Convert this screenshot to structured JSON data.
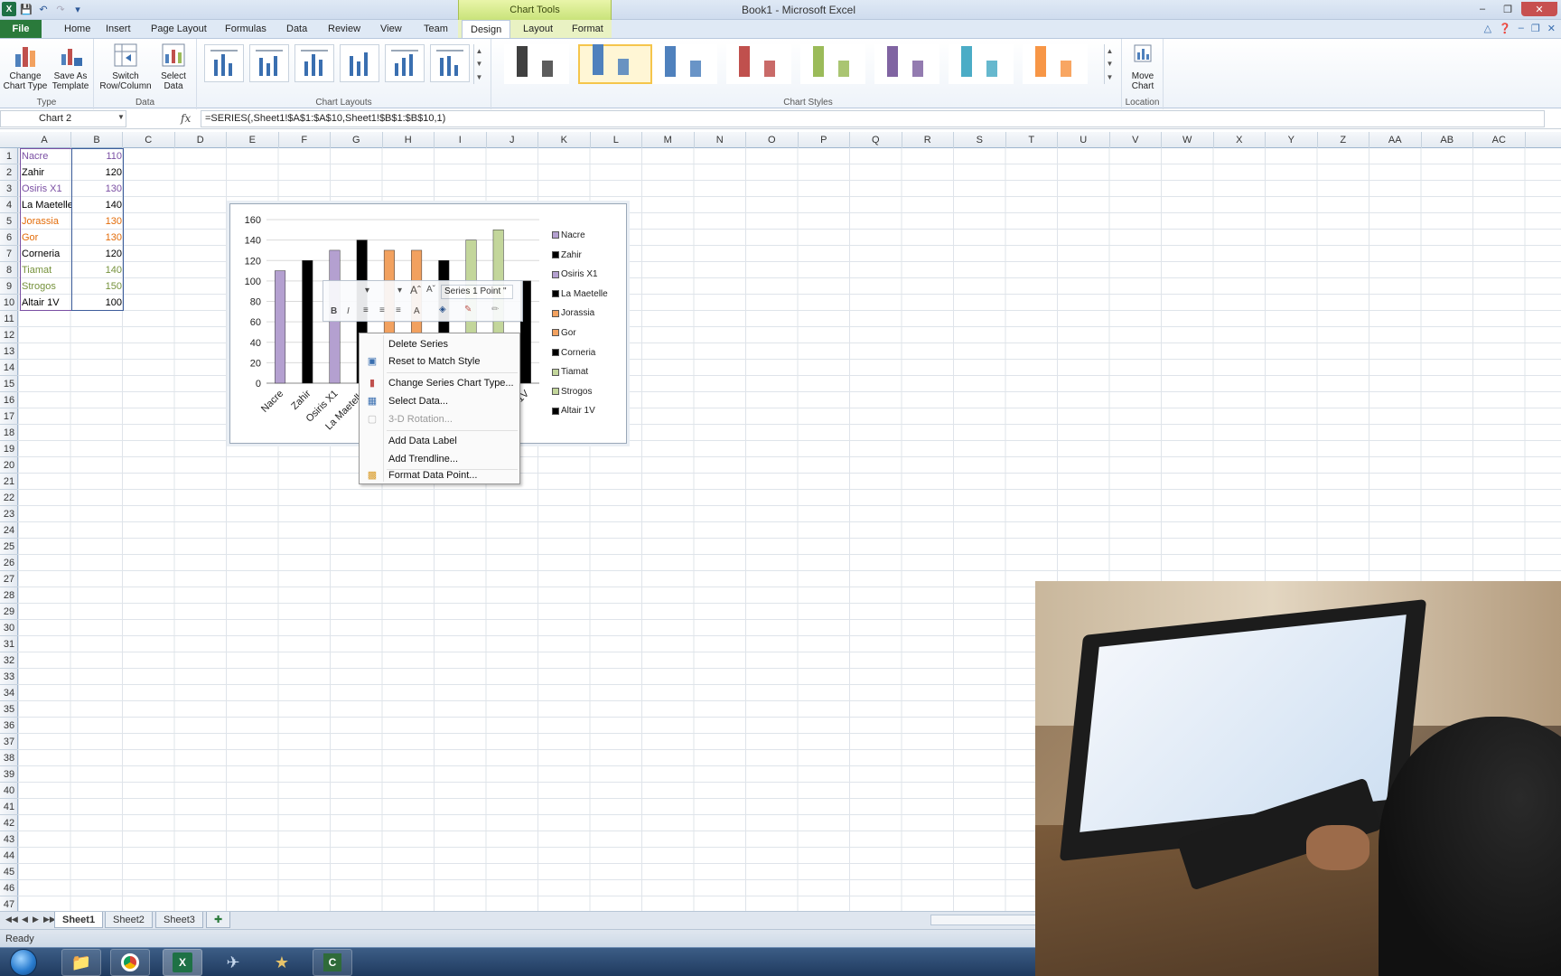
{
  "window": {
    "title": "Book1  -  Microsoft Excel",
    "contextual_tab_group": "Chart Tools"
  },
  "tabs": [
    {
      "label": "File"
    },
    {
      "label": "Home"
    },
    {
      "label": "Insert"
    },
    {
      "label": "Page Layout"
    },
    {
      "label": "Formulas"
    },
    {
      "label": "Data"
    },
    {
      "label": "Review"
    },
    {
      "label": "View"
    },
    {
      "label": "Team"
    },
    {
      "label": "Design"
    },
    {
      "label": "Layout"
    },
    {
      "label": "Format"
    }
  ],
  "active_tab": "Design",
  "ribbon": {
    "type_group": {
      "label": "Type",
      "change_chart_type": "Change Chart Type",
      "save_as_template": "Save As Template"
    },
    "data_group": {
      "label": "Data",
      "switch_row_column": "Switch Row/Column",
      "select_data": "Select Data"
    },
    "chart_layouts_group": {
      "label": "Chart Layouts"
    },
    "chart_styles_group": {
      "label": "Chart Styles",
      "styles": [
        {
          "color": "#404040"
        },
        {
          "color": "#4f81bd"
        },
        {
          "color": "#4f81bd"
        },
        {
          "color": "#c0504d"
        },
        {
          "color": "#9bbb59"
        },
        {
          "color": "#8064a2"
        },
        {
          "color": "#4bacc6"
        },
        {
          "color": "#f79646"
        }
      ],
      "selected_index": 1
    },
    "location_group": {
      "label": "Location",
      "move_chart": "Move Chart"
    }
  },
  "formula_bar": {
    "name_box": "Chart 2",
    "fx": "fx",
    "formula": "=SERIES(,Sheet1!$A$1:$A$10,Sheet1!$B$1:$B$10,1)"
  },
  "columns": [
    "A",
    "B",
    "C",
    "D",
    "E",
    "F",
    "G",
    "H",
    "I",
    "J",
    "K",
    "L",
    "M",
    "N",
    "O",
    "P",
    "Q",
    "R",
    "S",
    "T",
    "U",
    "V",
    "W",
    "X",
    "Y",
    "Z",
    "AA",
    "AB",
    "AC"
  ],
  "rows": [
    "1",
    "2",
    "3",
    "4",
    "5",
    "6",
    "7",
    "8",
    "9",
    "10",
    "11",
    "12",
    "13",
    "14",
    "15",
    "16",
    "17",
    "18",
    "19",
    "20",
    "21",
    "22",
    "23",
    "24",
    "25",
    "26",
    "27",
    "28",
    "29",
    "30",
    "31",
    "32",
    "33",
    "34",
    "35",
    "36",
    "37",
    "38",
    "39",
    "40",
    "41",
    "42",
    "43",
    "44",
    "45",
    "46",
    "47"
  ],
  "sheet_data": [
    {
      "name": "Nacre",
      "value": "110",
      "color": "#7a4fa3"
    },
    {
      "name": "Zahir",
      "value": "120",
      "color": "#000000"
    },
    {
      "name": "Osiris X1",
      "value": "130",
      "color": "#7a4fa3"
    },
    {
      "name": "La Maetelle",
      "value": "140",
      "color": "#000000"
    },
    {
      "name": "Jorassia",
      "value": "130",
      "color": "#e36c09"
    },
    {
      "name": "Gor",
      "value": "130",
      "color": "#e36c09"
    },
    {
      "name": "Corneria",
      "value": "120",
      "color": "#000000"
    },
    {
      "name": "Tiamat",
      "value": "140",
      "color": "#76923c"
    },
    {
      "name": "Strogos",
      "value": "150",
      "color": "#76923c"
    },
    {
      "name": "Altair 1V",
      "value": "100",
      "color": "#000000"
    }
  ],
  "chart_data": {
    "type": "bar",
    "categories": [
      "Nacre",
      "Zahir",
      "Osiris X1",
      "La Maetelle",
      "Jorassia",
      "Gor",
      "Corneria",
      "Tiamat",
      "Strogos",
      "Altair 1V"
    ],
    "values": [
      110,
      120,
      130,
      140,
      130,
      130,
      120,
      140,
      150,
      100
    ],
    "bar_colors": [
      "#b4a0d0",
      "#000000",
      "#b4a0d0",
      "#000000",
      "#f2a15f",
      "#f2a15f",
      "#000000",
      "#c3d69b",
      "#c3d69b",
      "#000000"
    ],
    "ylim": [
      0,
      160
    ],
    "yticks": [
      "0",
      "20",
      "40",
      "60",
      "80",
      "100",
      "120",
      "140",
      "160"
    ],
    "legend": "right",
    "title": "",
    "xlabel": "",
    "ylabel": ""
  },
  "mini_toolbar": {
    "series_select": "Series 1 Point \""
  },
  "context_menu": {
    "items": [
      {
        "label": "Delete Series",
        "disabled": false
      },
      {
        "label": "Reset to Match Style",
        "disabled": false
      },
      {
        "label": "Change Series Chart Type...",
        "disabled": false
      },
      {
        "label": "Select Data...",
        "disabled": false
      },
      {
        "label": "3-D Rotation...",
        "disabled": true
      },
      {
        "label": "Add Data Label",
        "disabled": false
      },
      {
        "label": "Add Trendline...",
        "disabled": false
      },
      {
        "label": "Format Data Point...",
        "disabled": false
      }
    ]
  },
  "sheets": [
    "Sheet1",
    "Sheet2",
    "Sheet3"
  ],
  "active_sheet": "Sheet1",
  "status": "Ready"
}
